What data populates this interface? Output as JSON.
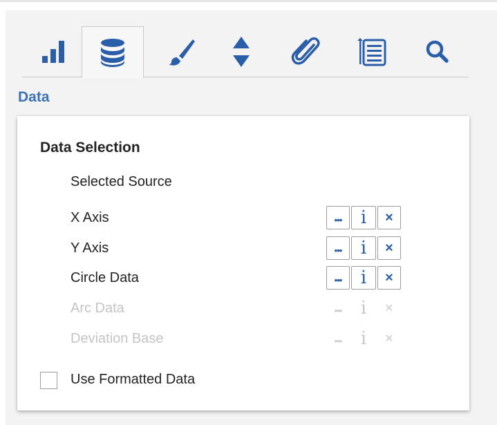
{
  "tabs": [
    {
      "id": "bar-chart-icon",
      "active": false
    },
    {
      "id": "database-icon",
      "active": true
    },
    {
      "id": "brush-icon",
      "active": false
    },
    {
      "id": "sort-arrows-icon",
      "active": false
    },
    {
      "id": "paperclip-icon",
      "active": false
    },
    {
      "id": "list-icon",
      "active": false
    },
    {
      "id": "search-icon",
      "active": false
    }
  ],
  "section_label": "Data",
  "card": {
    "title": "Data Selection",
    "selected_source_label": "Selected Source",
    "rows": [
      {
        "label": "X Axis",
        "enabled": true
      },
      {
        "label": "Y Axis",
        "enabled": true
      },
      {
        "label": "Circle Data",
        "enabled": true
      },
      {
        "label": "Arc Data",
        "enabled": false
      },
      {
        "label": "Deviation Base",
        "enabled": false
      }
    ],
    "button_glyphs": {
      "more": "•••",
      "info": "i",
      "clear": "×"
    },
    "use_formatted_label": "Use Formatted Data",
    "use_formatted_checked": false
  },
  "colors": {
    "accent": "#2a5ea8",
    "section_label": "#3b73b4",
    "disabled": "#c4c4c4"
  }
}
